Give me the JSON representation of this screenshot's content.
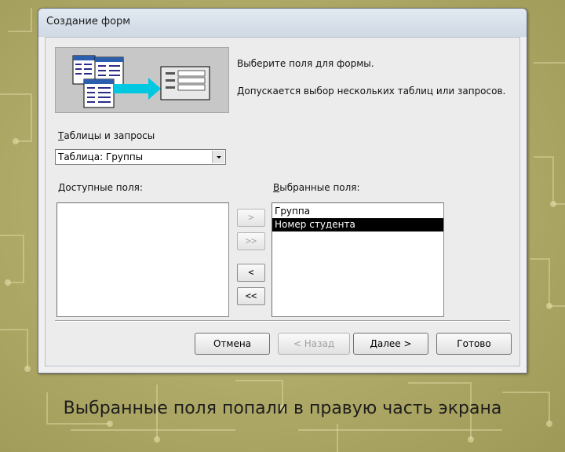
{
  "window": {
    "title": "Создание форм"
  },
  "wizard": {
    "hint_line1": "Выберите поля для формы.",
    "hint_line2": "Допускается выбор нескольких таблиц или запросов."
  },
  "tables": {
    "label": "Таблицы и запросы",
    "label_accel": "Т",
    "label_rest": "аблицы и запросы",
    "selected": "Таблица: Группы"
  },
  "available": {
    "label_accel": "Д",
    "label_rest": "оступные поля:",
    "items": []
  },
  "selected_fields": {
    "label_accel": "В",
    "label_rest": "ыбранные поля:",
    "items": [
      "Группа",
      "Номер студента"
    ],
    "highlighted": "Номер студента"
  },
  "move_buttons": {
    "add_one": ">",
    "add_all": ">>",
    "remove_one": "<",
    "remove_all": "<<"
  },
  "footer": {
    "cancel": "Отмена",
    "back": "< Назад",
    "next": "Далее >",
    "finish": "Готово"
  },
  "slide_caption": "Выбранные поля попали в правую часть экрана",
  "colors": {
    "background": "#b3ad6a",
    "dialog": "#ececec",
    "selection": "#000000",
    "illustration_arrow": "#00c8e0"
  }
}
